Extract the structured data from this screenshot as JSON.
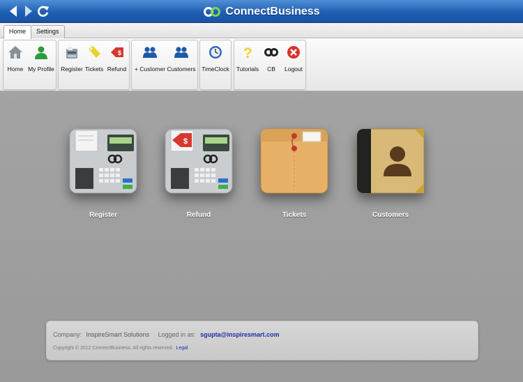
{
  "app": {
    "title": "ConnectBusiness",
    "accent_color": "#1f5fb4"
  },
  "tabs": [
    {
      "label": "Home",
      "active": true
    },
    {
      "label": "Settings",
      "active": false
    }
  ],
  "ribbon": {
    "groups": [
      {
        "items": [
          {
            "label": "Home",
            "icon": "house-icon"
          },
          {
            "label": "My Profile",
            "icon": "user-green-icon"
          }
        ]
      },
      {
        "items": [
          {
            "label": "Register",
            "icon": "register-icon"
          },
          {
            "label": "Tickets",
            "icon": "tag-icon"
          },
          {
            "label": "Refund",
            "icon": "refund-tag-icon"
          }
        ]
      },
      {
        "items": [
          {
            "label": "+ Customer",
            "icon": "add-customer-icon"
          },
          {
            "label": "Customers",
            "icon": "customers-icon"
          }
        ]
      },
      {
        "items": [
          {
            "label": "TimeClock",
            "icon": "clock-icon"
          }
        ]
      },
      {
        "items": [
          {
            "label": "Tutorials",
            "icon": "question-icon"
          },
          {
            "label": "CB",
            "icon": "cb-logo-icon"
          },
          {
            "label": "Logout",
            "icon": "logout-x-icon"
          }
        ]
      }
    ]
  },
  "tiles": [
    {
      "label": "Register",
      "icon": "cash-register-icon"
    },
    {
      "label": "Refund",
      "icon": "refund-register-icon"
    },
    {
      "label": "Tickets",
      "icon": "envelope-folder-icon"
    },
    {
      "label": "Customers",
      "icon": "address-book-icon"
    }
  ],
  "footer": {
    "company_label": "Company:",
    "company_value": "InspireSmart Solutions",
    "logged_label": "Logged in as:",
    "logged_value": "sgupta@inspiresmart.com",
    "copyright": "Copyright © 2012 ConnectBusiness. All rights reserved.",
    "legal_link": "Legal"
  }
}
